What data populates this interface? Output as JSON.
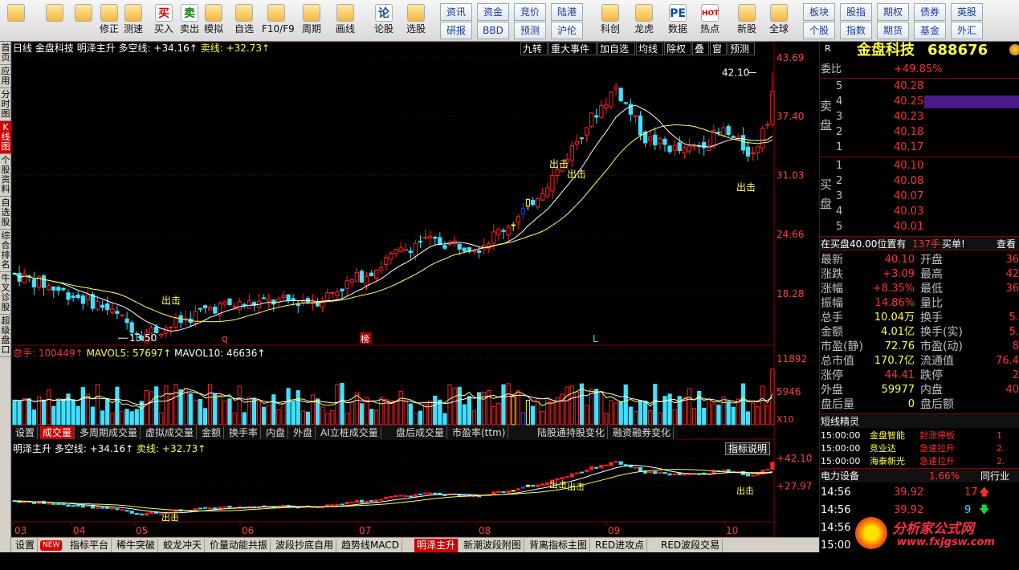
{
  "toolbar": {
    "left": [
      {
        "label": "",
        "icon": "grid-icon"
      },
      {
        "label": "",
        "icon": "back-arrow-icon"
      },
      {
        "label": "",
        "icon": "updown-icon"
      },
      {
        "label": "修正",
        "icon": "revise-icon"
      },
      {
        "label": "测速",
        "icon": "speed-icon"
      },
      {
        "label": "买入",
        "icon": "buy-icon",
        "glyph": "买"
      },
      {
        "label": "卖出",
        "icon": "sell-icon",
        "glyph": "卖"
      },
      {
        "label": "模拟",
        "icon": "simulate-icon"
      },
      {
        "label": "自选",
        "icon": "favorite-icon"
      },
      {
        "label": "F10/F9",
        "icon": "f10-icon"
      },
      {
        "label": "周期",
        "icon": "period-icon"
      },
      {
        "label": "画线",
        "icon": "draw-icon"
      },
      {
        "label": "论股",
        "icon": "discuss-icon",
        "glyph": "论"
      },
      {
        "label": "选股",
        "icon": "select-stock-icon"
      },
      {
        "label": "科创",
        "icon": "star-market-icon"
      },
      {
        "label": "龙虎",
        "icon": "dragon-tiger-icon"
      },
      {
        "label": "数据",
        "icon": "data-icon",
        "glyph": "PE"
      },
      {
        "label": "热点",
        "icon": "hotspot-icon",
        "glyph": "HOT"
      },
      {
        "label": "新股",
        "icon": "new-stock-icon"
      },
      {
        "label": "全球",
        "icon": "globe-icon"
      }
    ],
    "small_top": [
      "资讯",
      "资金",
      "竞价",
      "陆港"
    ],
    "small_bottom": [
      "研报",
      "BBD",
      "预测",
      "沪伦"
    ],
    "right_top": [
      "板块",
      "股指",
      "期权",
      "债券",
      "英股"
    ],
    "right_bottom": [
      "个股",
      "指数",
      "期货",
      "基金",
      "外汇"
    ]
  },
  "left_tabs": [
    {
      "label": "首页",
      "active": false
    },
    {
      "label": "应用",
      "active": false
    },
    {
      "label": "分时图",
      "active": false
    },
    {
      "label": "K线图",
      "active": true
    },
    {
      "label": "个股资料",
      "active": false
    },
    {
      "label": "自选股",
      "active": false
    },
    {
      "label": "综合排名",
      "active": false
    },
    {
      "label": "牛叉诊股",
      "active": false
    },
    {
      "label": "超级盘口",
      "active": false
    }
  ],
  "chart_header": {
    "period": "日线",
    "name": "金盘科技",
    "indicator": "明泽主升",
    "longline_label": "多空线:",
    "longline_value": "+34.16↑",
    "sell_label": "卖线:",
    "sell_value": "+32.73↑"
  },
  "top_right_buttons": [
    "九转",
    "重大事件",
    "加自选",
    "均线",
    "除权",
    "叠",
    "窗",
    "预测"
  ],
  "volume_header": {
    "total_label": "总手:",
    "total_value": "100449↑",
    "mavol5_label": "MAVOL5:",
    "mavol5_value": "57697↑",
    "mavol10_label": "MAVOL10:",
    "mavol10_value": "46636↑"
  },
  "volume_tabs": [
    {
      "label": "设置",
      "active": false
    },
    {
      "label": "成交量",
      "active": true
    },
    {
      "label": "多周期成交量",
      "active": false
    },
    {
      "label": "虚拟成交量",
      "active": false
    },
    {
      "label": "金额",
      "active": false
    },
    {
      "label": "换手率",
      "active": false
    },
    {
      "label": "内盘",
      "active": false
    },
    {
      "label": "外盘",
      "active": false
    },
    {
      "label": "AI立桩成交量",
      "active": false
    },
    {
      "label": "盘后成交量",
      "active": false
    },
    {
      "label": "市盈率(ttm)",
      "active": false
    },
    {
      "label": "陆股通持股变化",
      "active": false
    },
    {
      "label": "融资融券变化",
      "active": false
    }
  ],
  "indicator_header": {
    "name": "明泽主升",
    "longline_label": "多空线:",
    "longline_value": "+34.16↑",
    "sell_label": "卖线:",
    "sell_value": "+32.73↑",
    "explain_button": "指标说明"
  },
  "price_axis": [
    "43.69",
    "37.40",
    "31.03",
    "24.66",
    "18.28"
  ],
  "volume_axis": [
    "11892",
    "5946"
  ],
  "volume_unit": "X10",
  "indicator_axis": [
    "+42.10",
    "+27.97"
  ],
  "month_axis": [
    "03",
    "04",
    "05",
    "06",
    "07",
    "08",
    "09",
    "10"
  ],
  "annotations": {
    "high_label": "42.10",
    "low_label": "13.50",
    "chuji": "出击",
    "marker_q": "q",
    "marker_bang": "榜",
    "marker_L": "L"
  },
  "bottom_tabs": [
    {
      "label": "设置",
      "active": false
    },
    {
      "label": "NEW",
      "active": false,
      "badge": true
    },
    {
      "label": "指标平台",
      "active": false
    },
    {
      "label": "稀牛突破",
      "active": false
    },
    {
      "label": "蛟龙冲天",
      "active": false
    },
    {
      "label": "价量动能共振",
      "active": false
    },
    {
      "label": "波段抄底自用",
      "active": false
    },
    {
      "label": "趋势线MACD",
      "active": false
    },
    {
      "label": "明泽主升",
      "active": true
    },
    {
      "label": "新潮波段附图",
      "active": false
    },
    {
      "label": "背离指标主图",
      "active": false
    },
    {
      "label": "RED进攻点",
      "active": false
    },
    {
      "label": "RED波段交易",
      "active": false
    }
  ],
  "right_panel": {
    "r_badge": "R",
    "stock_name": "金盘科技",
    "stock_code": "688676",
    "weibi_label": "委比",
    "weibi_value": "+49.85%",
    "sell_label": "卖盘",
    "buy_label": "买盘",
    "asks": [
      {
        "level": "5",
        "price": "40.28"
      },
      {
        "level": "4",
        "price": "40.25"
      },
      {
        "level": "3",
        "price": "40.23"
      },
      {
        "level": "2",
        "price": "40.18"
      },
      {
        "level": "1",
        "price": "40.17"
      }
    ],
    "bids": [
      {
        "level": "1",
        "price": "40.10"
      },
      {
        "level": "2",
        "price": "40.08"
      },
      {
        "level": "3",
        "price": "40.07"
      },
      {
        "level": "4",
        "price": "40.03"
      },
      {
        "level": "5",
        "price": "40.01"
      }
    ],
    "notice": "在买盘40.00位置有",
    "notice_qty": "137手",
    "notice_action": "买单!",
    "notice_view": "查看",
    "quotes": [
      {
        "l1": "最新",
        "v1": "40.10",
        "l2": "开盘",
        "v2": "36"
      },
      {
        "l1": "涨跌",
        "v1": "+3.09",
        "l2": "最高",
        "v2": "42"
      },
      {
        "l1": "涨幅",
        "v1": "+8.35%",
        "l2": "最低",
        "v2": "36"
      },
      {
        "l1": "振幅",
        "v1": "14.86%",
        "l2": "量比",
        "v2": ""
      },
      {
        "l1": "总手",
        "v1": "10.04万",
        "l2": "换手",
        "v2": "5."
      },
      {
        "l1": "金额",
        "v1": "4.01亿",
        "l2": "换手(实)",
        "v2": "5."
      },
      {
        "l1": "市盈(静)",
        "v1": "72.76",
        "l2": "市盈(动)",
        "v2": "8"
      },
      {
        "l1": "总市值",
        "v1": "170.7亿",
        "l2": "流通值",
        "v2": "76.4"
      },
      {
        "l1": "涨停",
        "v1": "44.41",
        "l2": "跌停",
        "v2": "2"
      },
      {
        "l1": "外盘",
        "v1": "59977",
        "l2": "内盘",
        "v2": "40"
      },
      {
        "l1": "盘后量",
        "v1": "0",
        "l2": "盘后额",
        "v2": ""
      }
    ],
    "elf_title": "短线精灵",
    "elf": [
      {
        "time": "15:00:00",
        "name": "金盘智能",
        "event": "封涨停板",
        "val": "1"
      },
      {
        "time": "15:00:00",
        "name": "竞业达",
        "event": "急速拉升",
        "val": "2."
      },
      {
        "time": "15:00:00",
        "name": "海泰新光",
        "event": "急速拉升",
        "val": "2."
      }
    ],
    "settings_label": "电力设备",
    "settings_value": "1.66%",
    "settings_right": "同行业",
    "trades": [
      {
        "time": "14:56",
        "price": "39.92",
        "qty": "17",
        "dir": "up"
      },
      {
        "time": "14:56",
        "price": "39.92",
        "qty": "9",
        "dir": "down"
      },
      {
        "time": "14:56",
        "price": "",
        "qty": "",
        "dir": ""
      },
      {
        "time": "15:00",
        "price": "",
        "qty": "",
        "dir": ""
      }
    ]
  },
  "watermark": {
    "line1": "分析家公式网",
    "line2": "www.fxjgsw.com"
  },
  "colors": {
    "up": "#ff2020",
    "down": "#40e0ff",
    "ma_white": "#ffffff",
    "ma_yellow": "#ffff60",
    "grid": "#800000"
  }
}
